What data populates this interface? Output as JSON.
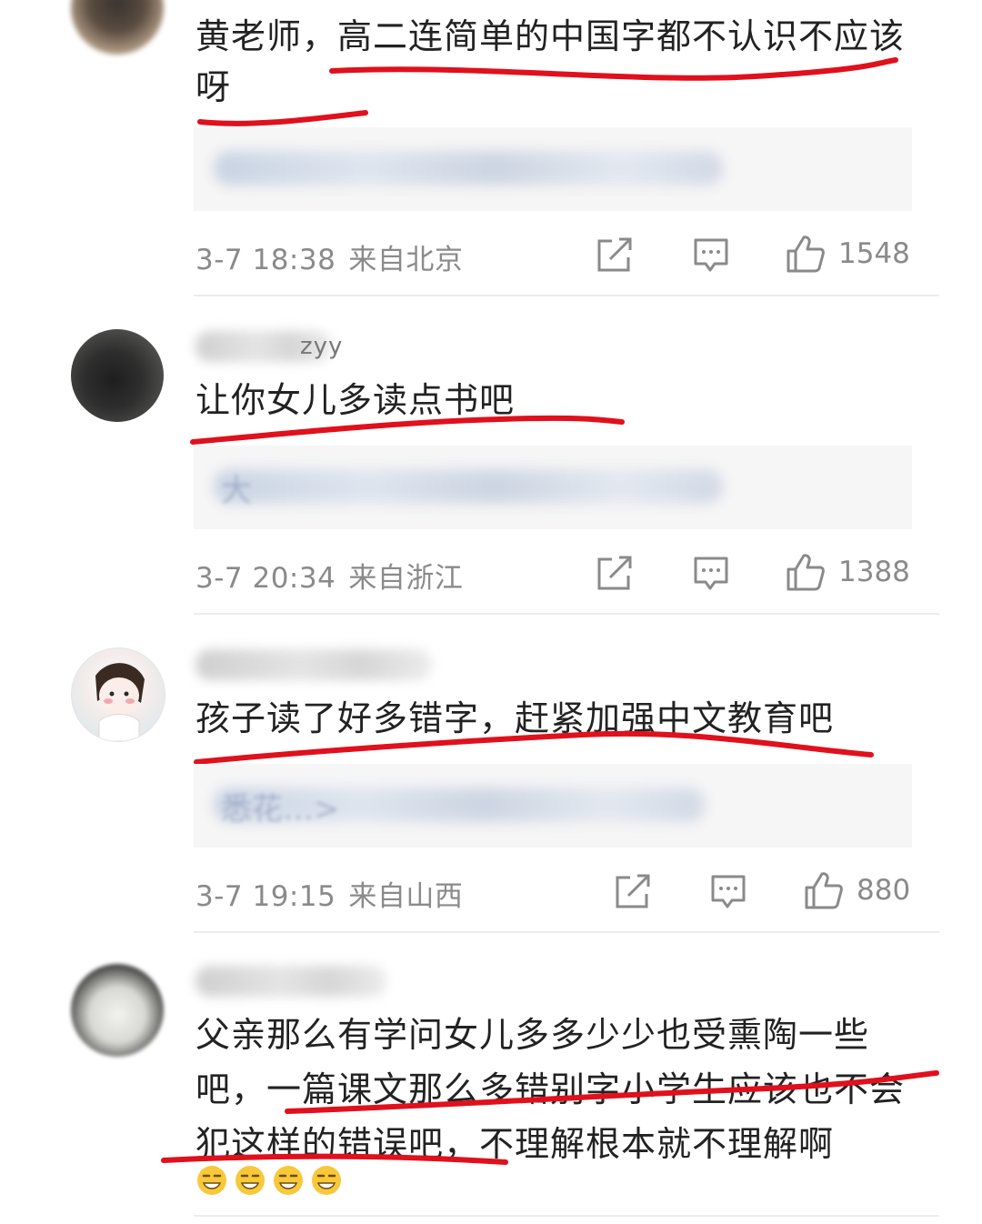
{
  "comments": [
    {
      "text": "黄老师，高二连简单的中国字都不认识不应该呀",
      "date": "3-7 18:38",
      "location": "来自北京",
      "likes": "1548"
    },
    {
      "username_tail": "zyy",
      "text": "让你女儿多读点书吧",
      "quote_ghost": "大",
      "date": "3-7 20:34",
      "location": "来自浙江",
      "likes": "1388"
    },
    {
      "text": "孩子读了好多错字，赶紧加强中文教育吧",
      "quote_ghost": "悉花…>",
      "date": "3-7 19:15",
      "location": "来自山西",
      "likes": "880"
    },
    {
      "text": "父亲那么有学问女儿多多少少也受熏陶一些吧，一篇课文那么多错别字小学生应该也不会犯这样的错误吧，不理解根本就不理解啊",
      "emoji_count": 4
    }
  ],
  "icons": {
    "share": "share-icon",
    "comment": "comment-icon",
    "like": "thumbs-up-icon",
    "emoji": "grinning-emoji-icon"
  },
  "colors": {
    "underline": "#e0101c",
    "meta_text": "#8a8a8a",
    "body_text": "#222222"
  }
}
